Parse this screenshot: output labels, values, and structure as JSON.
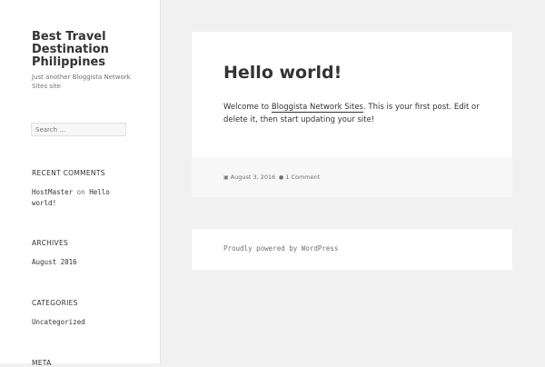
{
  "site": {
    "title": "Best Travel Destination Philippines",
    "description": "Just another Bloggista Network Sites site"
  },
  "search": {
    "placeholder": "Search …"
  },
  "widgets": {
    "recent_comments": {
      "title": "RECENT COMMENTS",
      "author": "HostMaster",
      "on": "on",
      "post": "Hello world!"
    },
    "archives": {
      "title": "ARCHIVES",
      "items": [
        "August 2016"
      ]
    },
    "categories": {
      "title": "CATEGORIES",
      "items": [
        "Uncategorized"
      ]
    },
    "meta": {
      "title": "META"
    }
  },
  "post": {
    "title": "Hello world!",
    "content_before": "Welcome to ",
    "content_link": "Bloggista Network Sites",
    "content_after": ". This is your first post. Edit or delete it, then start updating your site!",
    "date": "August 3, 2016",
    "comments": "1 Comment"
  },
  "footer": {
    "text": "Proudly powered by WordPress"
  },
  "icons": {
    "date": "calendar-icon",
    "comments": "comment-icon"
  }
}
